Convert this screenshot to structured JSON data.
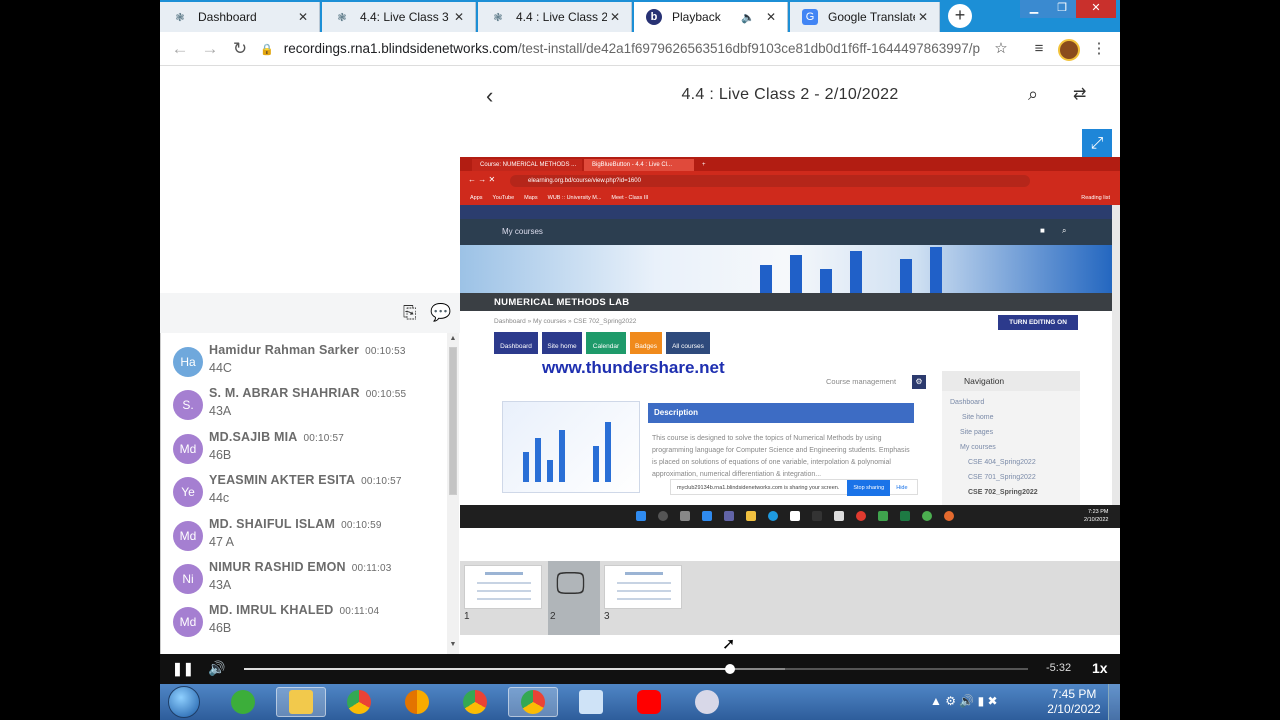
{
  "browser": {
    "tabs": [
      {
        "label": "Dashboard",
        "icon": "moodle-icon",
        "active": false
      },
      {
        "label": "4.4: Live Class 3",
        "icon": "moodle-icon",
        "active": false
      },
      {
        "label": "4.4 : Live Class 2",
        "icon": "moodle-icon",
        "active": false
      },
      {
        "label": "Playback",
        "icon": "bigbluebutton-icon",
        "active": true
      },
      {
        "label": "Google Translate",
        "icon": "google-translate-icon",
        "active": false
      }
    ],
    "url_host": "recordings.rna1.blindsidenetworks.com",
    "url_path": "/test-install/de42a1f6979626563516dbf9103ce81db0d1f6ff-1644497863997/p..."
  },
  "sidebar": {
    "messages": [
      {
        "initials": "Ha",
        "name": "Hamidur Rahman Sarker",
        "time": "00:10:53",
        "text": "44C",
        "color": "#6fa8dc"
      },
      {
        "initials": "S.",
        "name": "S. M. ABRAR SHAHRIAR",
        "time": "00:10:55",
        "text": "43A",
        "color": "#a57fd1"
      },
      {
        "initials": "Md",
        "name": "MD.SAJIB MIA",
        "time": "00:10:57",
        "text": "46B",
        "color": "#a57fd1"
      },
      {
        "initials": "Ye",
        "name": "YEASMIN AKTER ESITA",
        "time": "00:10:57",
        "text": "44c",
        "color": "#a57fd1"
      },
      {
        "initials": "Md",
        "name": "MD. SHAIFUL ISLAM",
        "time": "00:10:59",
        "text": "47 A",
        "color": "#a57fd1"
      },
      {
        "initials": "Ni",
        "name": "NIMUR RASHID EMON",
        "time": "00:11:03",
        "text": "43A",
        "color": "#a57fd1"
      },
      {
        "initials": "Md",
        "name": "MD. IMRUL KHALED",
        "time": "00:11:04",
        "text": "46B",
        "color": "#a57fd1"
      }
    ]
  },
  "playback": {
    "title": "4.4 : Live Class 2 - 2/10/2022"
  },
  "video": {
    "tab1": "Course: NUMERICAL METHODS ...",
    "tab2": "BigBlueButton - 4.4 : Live Cl...",
    "url": "elearning.org.bd/course/view.php?id=1600",
    "bookmarks": [
      "Apps",
      "YouTube",
      "Maps",
      "WUB :: University M...",
      "Meet - Class III"
    ],
    "reading_list": "Reading list",
    "my_courses": "My courses",
    "course_title": "NUMERICAL METHODS LAB",
    "breadcrumb": "Dashboard  »  My courses  »  CSE 702_Spring2022",
    "turn_editing": "TURN EDITING ON",
    "nav_buttons": [
      "Dashboard",
      "Site home",
      "Calendar",
      "Badges",
      "All courses"
    ],
    "watermark": "www.thundershare.net",
    "course_management": "Course management",
    "navigation_header": "Navigation",
    "navigation_items": [
      "Dashboard",
      "Site home",
      "Site pages",
      "My courses",
      "CSE 404_Spring2022",
      "CSE 701_Spring2022",
      "CSE 702_Spring2022"
    ],
    "description_header": "Description",
    "description_text": "This course is designed to solve the topics of Numerical Methods by using programming language for Computer Science and Engineering students. Emphasis is placed on solutions of equations of one variable, interpolation & polynomial approximation, numerical differentiation & integration...",
    "share_notice": "myclub29134b.rna1.blindsidenetworks.com is sharing your screen.",
    "stop_sharing": "Stop sharing",
    "hide": "Hide",
    "clock_time": "7:23 PM",
    "clock_date": "2/10/2022"
  },
  "thumbnails": [
    {
      "num": "1"
    },
    {
      "num": "2"
    },
    {
      "num": "3"
    }
  ],
  "player": {
    "progress": 0.62,
    "buffered": 0.69,
    "remaining": "-5:32",
    "speed": "1x"
  },
  "taskbar": {
    "time": "7:45 PM",
    "date": "2/10/2022",
    "apps": [
      "start-orb",
      "media-center",
      "file-explorer",
      "chrome",
      "chrome-canary",
      "chrome-profile-2",
      "chrome-profile-active",
      "remote-desktop",
      "youtube",
      "snipping-tool"
    ]
  }
}
